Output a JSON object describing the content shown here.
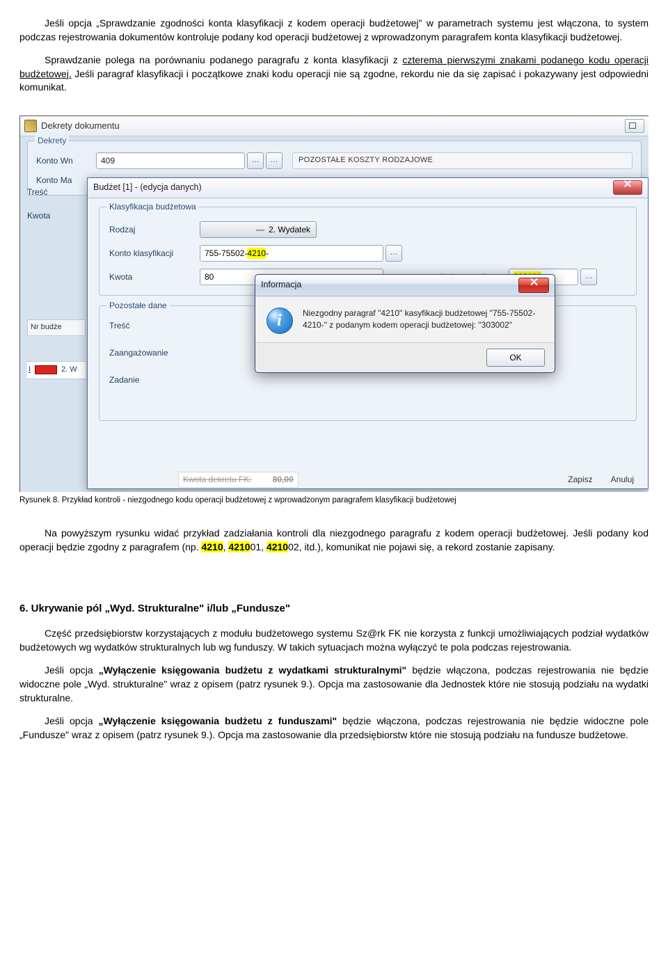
{
  "para1_a": "Jeśli opcja „Sprawdzanie zgodności konta klasyfikacji z kodem operacji budżetowej\" w parametrach systemu jest włączona, to system podczas rejestrowania dokumentów kontroluje podany kod operacji budżetowej z wprowadzonym paragrafem konta klasyfikacji budżetowej.",
  "para2_a": "Sprawdzanie polega na porównaniu podanego paragrafu z konta klasyfikacji z ",
  "para2_u": "czterema pierwszymi znakami podanego kodu operacji budżetowej.",
  "para2_b": " Jeśli paragraf klasyfikacji i początkowe znaki kodu operacji nie są zgodne, rekordu nie da się zapisać i pokazywany jest odpowiedni komunikat.",
  "win_title": "Dekrety dokumentu",
  "dekrety_group": "Dekrety",
  "konto_wn_lbl": "Konto Wn",
  "konto_wn_val": "409",
  "konto_wn_desc": "POZOSTAŁE KOSZTY RODZAJOWE",
  "konto_ma_lbl": "Konto Ma",
  "tresc_lbl": "Treść",
  "kwota_lbl": "Kwota",
  "nrbudze": "Nr budże",
  "redrow_prefix": "I",
  "redrow_label": "2. W",
  "inner_title": "Budżet [1]  - (edycja danych)",
  "klas_group": "Klasyfikacja budżetowa",
  "rodzaj_lbl": "Rodzaj",
  "rodzaj_val": "2. Wydatek",
  "kontoklas_lbl": "Konto klasyfikacji",
  "kontoklas_pre": "755-75502-",
  "kontoklas_hl": "4210",
  "kontoklas_suf": "-",
  "kwota2_lbl": "Kwota",
  "kwota2_val": "80",
  "kodop_lbl": "Kod operacji",
  "kodop_val": "303002",
  "poz_group": "Pozostałe dane",
  "poz_tresc": "Treść",
  "poz_zaang": "Zaangażowanie",
  "poz_zadanie": "Zadanie",
  "msg_title": "Informacja",
  "msg_text": "Niezgodny paragraf \"4210\" kasyfikacji budżetowej \"755-75502-4210-\" z podanym kodem operacji budżetowej: \"303002\"",
  "ok_label": "OK",
  "bottom_kwota_lbl": "Kwota dekretu FK:",
  "bottom_kwota_val": "80,00",
  "btn_zapisz": "Zapisz",
  "btn_anuluj": "Anuluj",
  "caption": "Rysunek 8.  Przykład kontroli - niezgodnego kodu operacji budżetowej z wprowadzonym paragrafem klasyfikacji budżetowej",
  "para3_a": "Na powyższym rysunku widać przykład zadziałania kontroli dla niezgodnego paragrafu z kodem operacji budżetowej.  Jeśli podany kod operacji będzie zgodny z paragrafem (np. ",
  "hl1": "4210",
  "para3_b": ", ",
  "hl2": "4210",
  "para3_c": "01, ",
  "hl3": "4210",
  "para3_d": "02, itd.), komunikat nie pojawi się, a rekord zostanie zapisany.",
  "heading6": "6. Ukrywanie pól „Wyd. Strukturalne\" i/lub „Fundusze\"",
  "para4": "Część przedsiębiorstw korzystających z modułu budżetowego systemu Sz@rk FK nie korzysta z funkcji umożliwiających podział wydatków budżetowych wg wydatków strukturalnych lub wg funduszy. W takich sytuacjach można wyłączyć te pola podczas rejestrowania.",
  "para5_a": "Jeśli opcja ",
  "para5_b": "„Wyłączenie księgowania budżetu z wydatkami strukturalnymi\"",
  "para5_c": " będzie włączona, podczas rejestrowania nie będzie widoczne pole „Wyd. strukturalne\" wraz z opisem (patrz rysunek 9.).  Opcja ma zastosowanie dla Jednostek które nie stosują podziału na wydatki strukturalne.",
  "para6_a": "Jeśli opcja ",
  "para6_b": "„Wyłączenie księgowania budżetu z funduszami\"",
  "para6_c": " będzie włączona, podczas rejestrowania nie będzie widoczne pole „Fundusze\" wraz z opisem (patrz rysunek 9.).  Opcja ma zastosowanie dla przedsiębiorstw które nie stosują podziału na  fundusze budżetowe."
}
